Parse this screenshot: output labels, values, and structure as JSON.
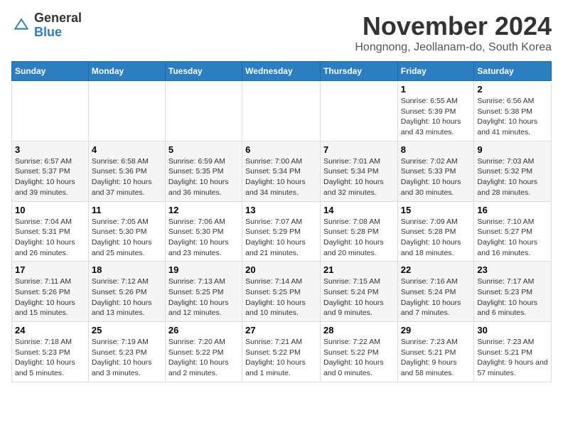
{
  "header": {
    "logo_general": "General",
    "logo_blue": "Blue",
    "month": "November 2024",
    "location": "Hongnong, Jeollanam-do, South Korea"
  },
  "days_of_week": [
    "Sunday",
    "Monday",
    "Tuesday",
    "Wednesday",
    "Thursday",
    "Friday",
    "Saturday"
  ],
  "weeks": [
    [
      {
        "date": "",
        "sunrise": "",
        "sunset": "",
        "daylight": ""
      },
      {
        "date": "",
        "sunrise": "",
        "sunset": "",
        "daylight": ""
      },
      {
        "date": "",
        "sunrise": "",
        "sunset": "",
        "daylight": ""
      },
      {
        "date": "",
        "sunrise": "",
        "sunset": "",
        "daylight": ""
      },
      {
        "date": "",
        "sunrise": "",
        "sunset": "",
        "daylight": ""
      },
      {
        "date": "1",
        "sunrise": "Sunrise: 6:55 AM",
        "sunset": "Sunset: 5:39 PM",
        "daylight": "Daylight: 10 hours and 43 minutes."
      },
      {
        "date": "2",
        "sunrise": "Sunrise: 6:56 AM",
        "sunset": "Sunset: 5:38 PM",
        "daylight": "Daylight: 10 hours and 41 minutes."
      }
    ],
    [
      {
        "date": "3",
        "sunrise": "Sunrise: 6:57 AM",
        "sunset": "Sunset: 5:37 PM",
        "daylight": "Daylight: 10 hours and 39 minutes."
      },
      {
        "date": "4",
        "sunrise": "Sunrise: 6:58 AM",
        "sunset": "Sunset: 5:36 PM",
        "daylight": "Daylight: 10 hours and 37 minutes."
      },
      {
        "date": "5",
        "sunrise": "Sunrise: 6:59 AM",
        "sunset": "Sunset: 5:35 PM",
        "daylight": "Daylight: 10 hours and 36 minutes."
      },
      {
        "date": "6",
        "sunrise": "Sunrise: 7:00 AM",
        "sunset": "Sunset: 5:34 PM",
        "daylight": "Daylight: 10 hours and 34 minutes."
      },
      {
        "date": "7",
        "sunrise": "Sunrise: 7:01 AM",
        "sunset": "Sunset: 5:34 PM",
        "daylight": "Daylight: 10 hours and 32 minutes."
      },
      {
        "date": "8",
        "sunrise": "Sunrise: 7:02 AM",
        "sunset": "Sunset: 5:33 PM",
        "daylight": "Daylight: 10 hours and 30 minutes."
      },
      {
        "date": "9",
        "sunrise": "Sunrise: 7:03 AM",
        "sunset": "Sunset: 5:32 PM",
        "daylight": "Daylight: 10 hours and 28 minutes."
      }
    ],
    [
      {
        "date": "10",
        "sunrise": "Sunrise: 7:04 AM",
        "sunset": "Sunset: 5:31 PM",
        "daylight": "Daylight: 10 hours and 26 minutes."
      },
      {
        "date": "11",
        "sunrise": "Sunrise: 7:05 AM",
        "sunset": "Sunset: 5:30 PM",
        "daylight": "Daylight: 10 hours and 25 minutes."
      },
      {
        "date": "12",
        "sunrise": "Sunrise: 7:06 AM",
        "sunset": "Sunset: 5:30 PM",
        "daylight": "Daylight: 10 hours and 23 minutes."
      },
      {
        "date": "13",
        "sunrise": "Sunrise: 7:07 AM",
        "sunset": "Sunset: 5:29 PM",
        "daylight": "Daylight: 10 hours and 21 minutes."
      },
      {
        "date": "14",
        "sunrise": "Sunrise: 7:08 AM",
        "sunset": "Sunset: 5:28 PM",
        "daylight": "Daylight: 10 hours and 20 minutes."
      },
      {
        "date": "15",
        "sunrise": "Sunrise: 7:09 AM",
        "sunset": "Sunset: 5:28 PM",
        "daylight": "Daylight: 10 hours and 18 minutes."
      },
      {
        "date": "16",
        "sunrise": "Sunrise: 7:10 AM",
        "sunset": "Sunset: 5:27 PM",
        "daylight": "Daylight: 10 hours and 16 minutes."
      }
    ],
    [
      {
        "date": "17",
        "sunrise": "Sunrise: 7:11 AM",
        "sunset": "Sunset: 5:26 PM",
        "daylight": "Daylight: 10 hours and 15 minutes."
      },
      {
        "date": "18",
        "sunrise": "Sunrise: 7:12 AM",
        "sunset": "Sunset: 5:26 PM",
        "daylight": "Daylight: 10 hours and 13 minutes."
      },
      {
        "date": "19",
        "sunrise": "Sunrise: 7:13 AM",
        "sunset": "Sunset: 5:25 PM",
        "daylight": "Daylight: 10 hours and 12 minutes."
      },
      {
        "date": "20",
        "sunrise": "Sunrise: 7:14 AM",
        "sunset": "Sunset: 5:25 PM",
        "daylight": "Daylight: 10 hours and 10 minutes."
      },
      {
        "date": "21",
        "sunrise": "Sunrise: 7:15 AM",
        "sunset": "Sunset: 5:24 PM",
        "daylight": "Daylight: 10 hours and 9 minutes."
      },
      {
        "date": "22",
        "sunrise": "Sunrise: 7:16 AM",
        "sunset": "Sunset: 5:24 PM",
        "daylight": "Daylight: 10 hours and 7 minutes."
      },
      {
        "date": "23",
        "sunrise": "Sunrise: 7:17 AM",
        "sunset": "Sunset: 5:23 PM",
        "daylight": "Daylight: 10 hours and 6 minutes."
      }
    ],
    [
      {
        "date": "24",
        "sunrise": "Sunrise: 7:18 AM",
        "sunset": "Sunset: 5:23 PM",
        "daylight": "Daylight: 10 hours and 5 minutes."
      },
      {
        "date": "25",
        "sunrise": "Sunrise: 7:19 AM",
        "sunset": "Sunset: 5:23 PM",
        "daylight": "Daylight: 10 hours and 3 minutes."
      },
      {
        "date": "26",
        "sunrise": "Sunrise: 7:20 AM",
        "sunset": "Sunset: 5:22 PM",
        "daylight": "Daylight: 10 hours and 2 minutes."
      },
      {
        "date": "27",
        "sunrise": "Sunrise: 7:21 AM",
        "sunset": "Sunset: 5:22 PM",
        "daylight": "Daylight: 10 hours and 1 minute."
      },
      {
        "date": "28",
        "sunrise": "Sunrise: 7:22 AM",
        "sunset": "Sunset: 5:22 PM",
        "daylight": "Daylight: 10 hours and 0 minutes."
      },
      {
        "date": "29",
        "sunrise": "Sunrise: 7:23 AM",
        "sunset": "Sunset: 5:21 PM",
        "daylight": "Daylight: 9 hours and 58 minutes."
      },
      {
        "date": "30",
        "sunrise": "Sunrise: 7:23 AM",
        "sunset": "Sunset: 5:21 PM",
        "daylight": "Daylight: 9 hours and 57 minutes."
      }
    ]
  ]
}
